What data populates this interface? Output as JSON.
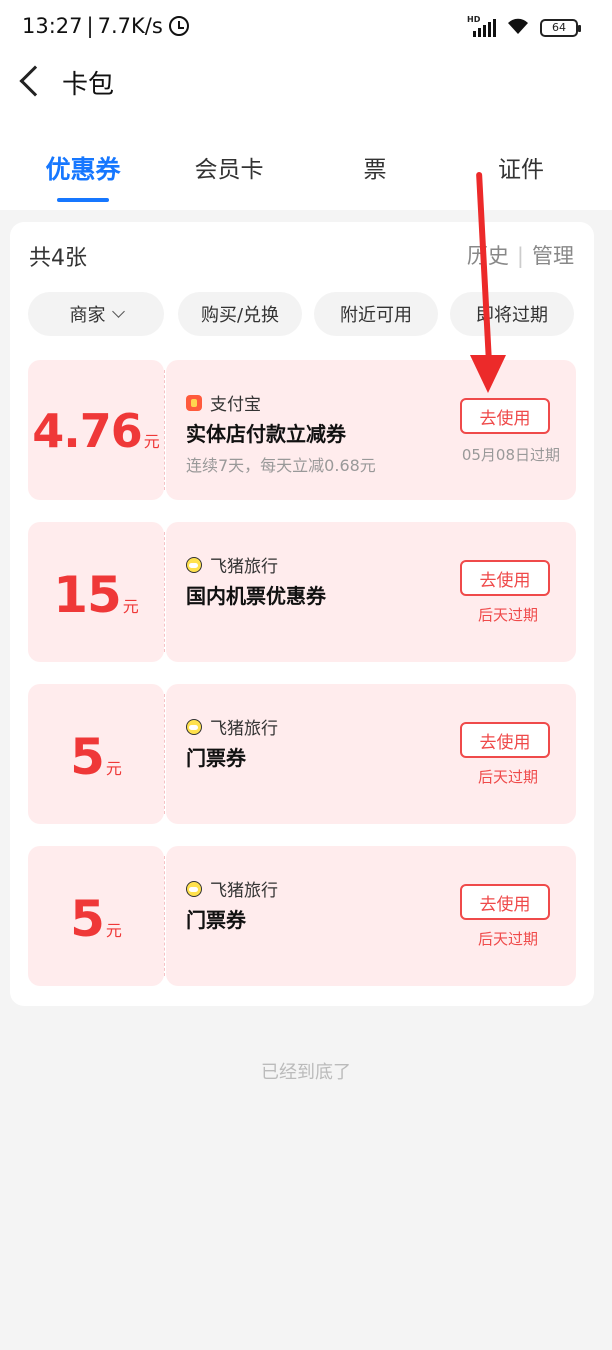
{
  "status_bar": {
    "time": "13:27",
    "network_speed": "7.7K/s",
    "battery": "64",
    "network_type": "HD"
  },
  "header": {
    "title": "卡包"
  },
  "tabs": [
    {
      "label": "优惠券",
      "active": true
    },
    {
      "label": "会员卡",
      "active": false
    },
    {
      "label": "票",
      "active": false
    },
    {
      "label": "证件",
      "active": false
    }
  ],
  "summary": {
    "count": "共4张",
    "history": "历史",
    "manage": "管理"
  },
  "filters": [
    {
      "label": "商家"
    },
    {
      "label": "购买/兑换"
    },
    {
      "label": "附近可用"
    },
    {
      "label": "即将过期"
    }
  ],
  "coupons": [
    {
      "amount": "4.76",
      "unit": "元",
      "merchant": "支付宝",
      "merchant_icon": "alipay-icon",
      "name": "实体店付款立减券",
      "desc": "连续7天，每天立减0.68元",
      "button": "去使用",
      "expiry": "05月08日过期",
      "expiry_color": "#999999"
    },
    {
      "amount": "15",
      "unit": "元",
      "merchant": "飞猪旅行",
      "merchant_icon": "fliggy-icon",
      "name": "国内机票优惠券",
      "desc": "",
      "button": "去使用",
      "expiry": "后天过期",
      "expiry_color": "#ef4a4a"
    },
    {
      "amount": "5",
      "unit": "元",
      "merchant": "飞猪旅行",
      "merchant_icon": "fliggy-icon",
      "name": "门票券",
      "desc": "",
      "button": "去使用",
      "expiry": "后天过期",
      "expiry_color": "#ef4a4a"
    },
    {
      "amount": "5",
      "unit": "元",
      "merchant": "飞猪旅行",
      "merchant_icon": "fliggy-icon",
      "name": "门票券",
      "desc": "",
      "button": "去使用",
      "expiry": "后天过期",
      "expiry_color": "#ef4a4a"
    }
  ],
  "footer": {
    "end_note": "已经到底了"
  },
  "colors": {
    "accent": "#1677ff",
    "coupon_red": "#ef3838",
    "coupon_bg": "#ffeced"
  }
}
